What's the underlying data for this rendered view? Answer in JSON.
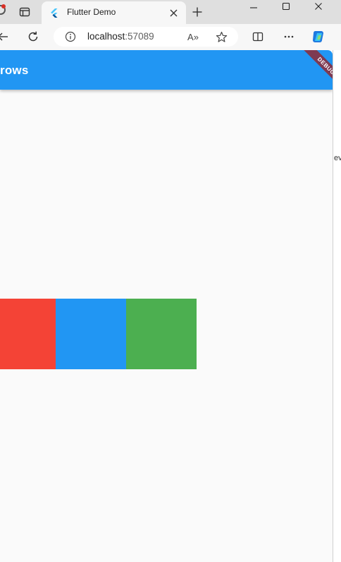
{
  "browser": {
    "tab": {
      "title": "Flutter Demo",
      "favicon": "flutter-logo-icon"
    },
    "address": {
      "host": "localhost",
      "port": ":57089"
    },
    "read_aloud_label": "A»",
    "icons": {
      "back": "back-arrow-icon",
      "reload": "reload-icon",
      "info": "info-icon",
      "favorite": "star-icon",
      "split": "split-screen-icon",
      "more": "ellipsis-icon",
      "copilot": "copilot-icon",
      "new_tab": "plus-icon",
      "close_tab": "close-icon",
      "minimize": "minimize-icon",
      "maximize": "maximize-icon",
      "close_window": "close-icon"
    }
  },
  "app": {
    "title": "rows",
    "debug_banner": "DEBUG",
    "colors": {
      "appbar": "#2196f3",
      "background": "#fafafa",
      "debug": "#7e3a52"
    },
    "boxes": [
      {
        "name": "red-box",
        "color": "#f44336"
      },
      {
        "name": "blue-box",
        "color": "#2196f3"
      },
      {
        "name": "green-box",
        "color": "#4caf50"
      }
    ]
  },
  "side_text": "ev"
}
